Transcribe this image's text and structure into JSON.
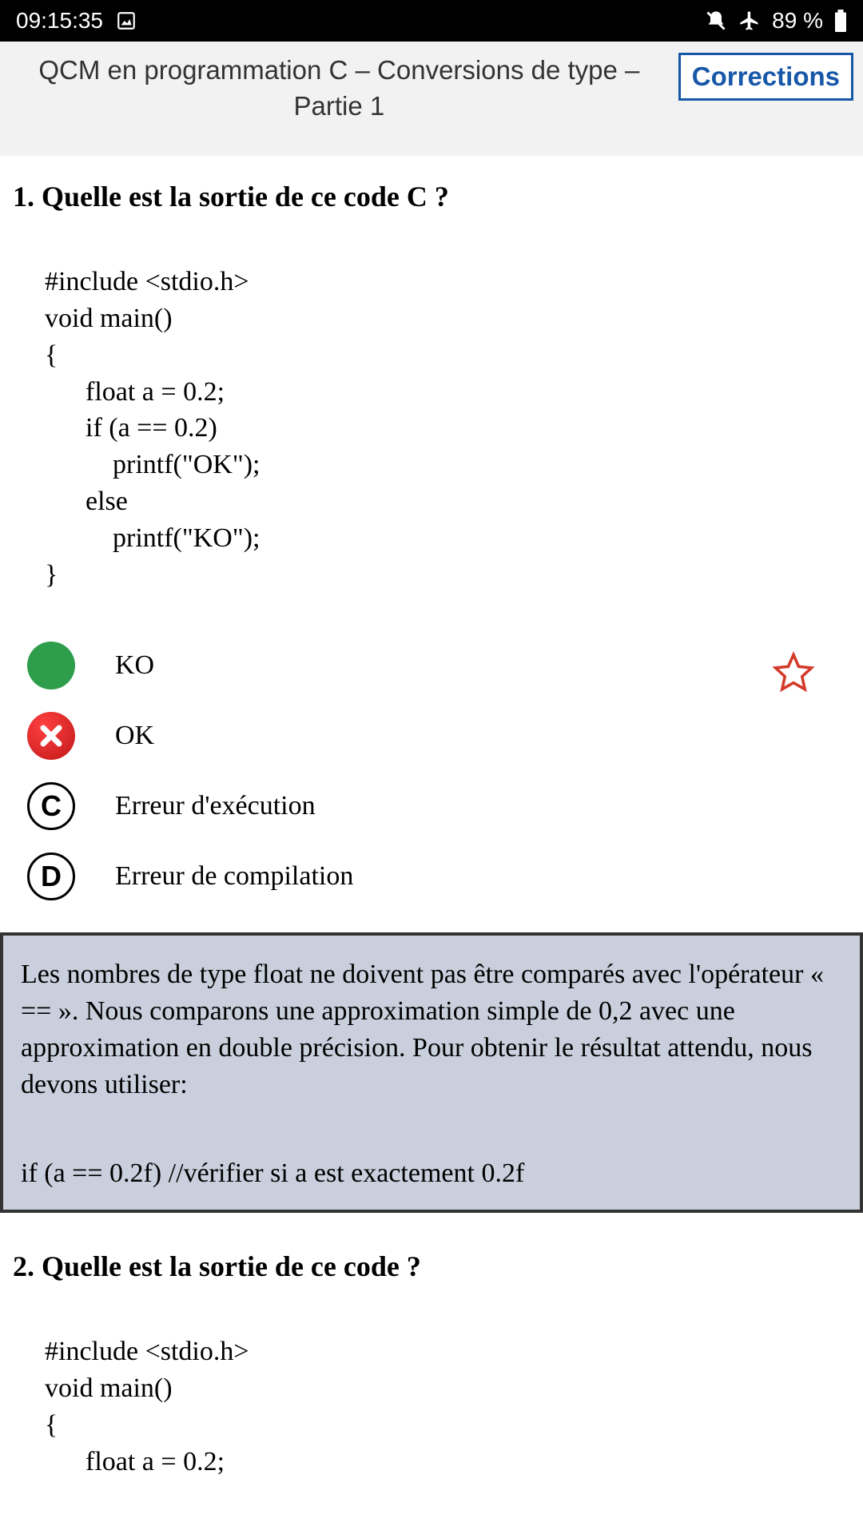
{
  "status_bar": {
    "time": "09:15:35",
    "battery": "89 %"
  },
  "header": {
    "title": "QCM en programmation C – Conversions de type – Partie 1",
    "corrections_label": "Corrections"
  },
  "question1": {
    "title": "1. Quelle est la sortie de ce code C ?",
    "code": "#include <stdio.h>\nvoid main()\n{\n      float a = 0.2;\n      if (a == 0.2)\n          printf(\"OK\");\n      else\n          printf(\"KO\");\n}",
    "answers": [
      {
        "state": "correct",
        "letter": "",
        "text": "KO"
      },
      {
        "state": "wrong",
        "letter": "",
        "text": "OK"
      },
      {
        "state": "plain",
        "letter": "C",
        "text": "Erreur d'exécution"
      },
      {
        "state": "plain",
        "letter": "D",
        "text": "Erreur de compilation"
      }
    ],
    "explanation": {
      "text": "Les nombres de type float ne doivent pas être comparés avec l'opérateur « == ». Nous comparons une approximation simple de 0,2 avec une approximation en double précision. Pour obtenir le résultat attendu, nous devons utiliser:",
      "code": "if (a == 0.2f) //vérifier si a est exactement 0.2f"
    }
  },
  "question2": {
    "title": "2. Quelle est la sortie de ce code ?",
    "code": "#include <stdio.h>\nvoid main()\n{\n      float a = 0.2;"
  }
}
